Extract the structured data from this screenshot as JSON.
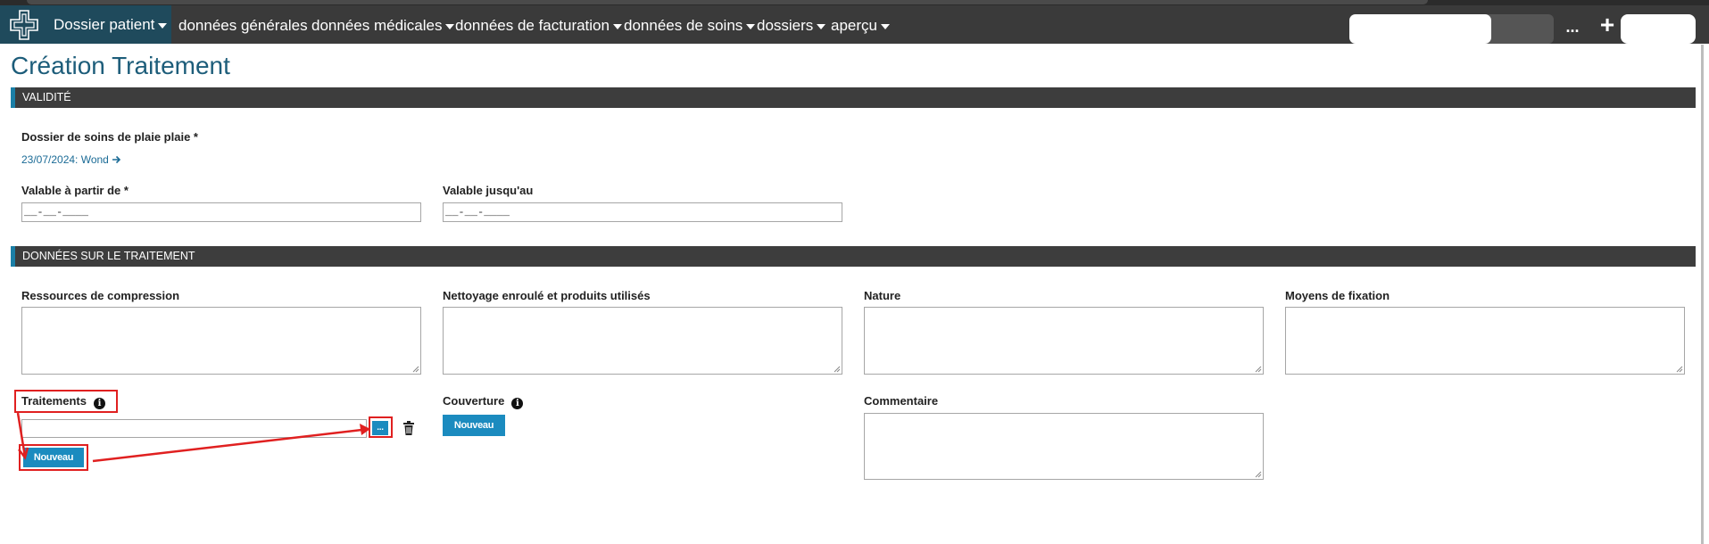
{
  "navbar": {
    "brand_label": "Dossier patient",
    "items": [
      {
        "label": "données générales",
        "has_dropdown": false
      },
      {
        "label": "données médicales",
        "has_dropdown": true
      },
      {
        "label": "données de facturation",
        "has_dropdown": true
      },
      {
        "label": "données de soins",
        "has_dropdown": true
      },
      {
        "label": "dossiers",
        "has_dropdown": true
      },
      {
        "label": "aperçu",
        "has_dropdown": true
      }
    ],
    "more_label": "...",
    "add_label": "+"
  },
  "page": {
    "title": "Création Traitement"
  },
  "sections": {
    "validity": {
      "title": "VALIDITÉ",
      "care_record_label": "Dossier de soins de plaie plaie *",
      "care_record_link": "23/07/2024: Wond",
      "valid_from_label": "Valable à partir de *",
      "valid_from_value": "__-__-____",
      "valid_until_label": "Valable jusqu'au",
      "valid_until_value": "__-__-____"
    },
    "treatment": {
      "title": "DONNÉES SUR LE TRAITEMENT",
      "compression_label": "Ressources de compression",
      "cleaning_label": "Nettoyage enroulé et produits utilisés",
      "nature_label": "Nature",
      "fixation_label": "Moyens de fixation",
      "treatments_label": "Traitements",
      "treatments_browse_label": "...",
      "treatments_new_label": "Nouveau",
      "coverage_label": "Couverture",
      "coverage_new_label": "Nouveau",
      "comment_label": "Commentaire"
    }
  },
  "colors": {
    "navbar": "#3a3a3a",
    "brand": "#1f4a5c",
    "title": "#1d5d7a",
    "section_bar": "#3d3d3d",
    "section_accent": "#1b7fa6",
    "button": "#1b8bbf",
    "annotation": "#e02020"
  },
  "icons": [
    "logo-icon",
    "chevron-down-icon",
    "arrow-right-icon",
    "info-icon",
    "trash-icon",
    "resize-grip-icon"
  ]
}
